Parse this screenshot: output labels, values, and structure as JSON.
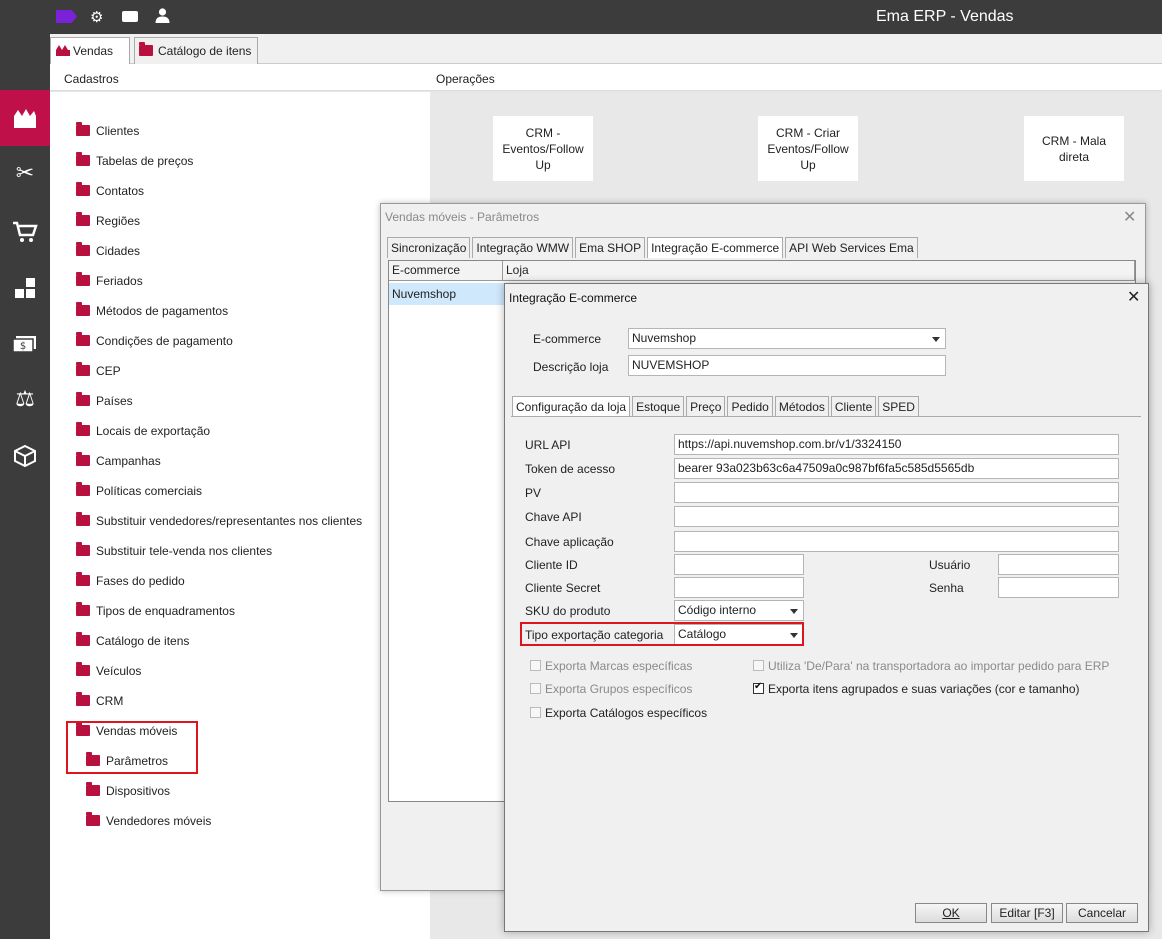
{
  "app": {
    "title": "Ema ERP - Vendas"
  },
  "topbar": {
    "icons": [
      "tag-icon",
      "gear-icon",
      "chat-icon",
      "user-icon"
    ]
  },
  "leftnav": {
    "icons": [
      "sales-icon",
      "tools-icon",
      "cart-icon",
      "inventory-icon",
      "finance-icon",
      "scale-icon",
      "box-icon"
    ]
  },
  "module_tabs": [
    {
      "label": "Vendas"
    },
    {
      "label": "Catálogo de itens"
    }
  ],
  "sections": {
    "cadastros": "Cadastros",
    "operacoes": "Operações"
  },
  "cadastros": [
    "Clientes",
    "Tabelas de preços",
    "Contatos",
    "Regiões",
    "Cidades",
    "Feriados",
    "Métodos de pagamentos",
    "Condições de pagamento",
    "CEP",
    "Países",
    "Locais de exportação",
    "Campanhas",
    "Políticas comerciais",
    "Substituir vendedores/representantes nos clientes",
    "Substituir tele-venda nos clientes",
    "Fases do pedido",
    "Tipos de enquadramentos",
    "Catálogo de itens",
    "Veículos",
    "CRM",
    "Vendas móveis",
    "Parâmetros",
    "Dispositivos",
    "Vendedores móveis"
  ],
  "operacoes": [
    "CRM - Eventos/Follow Up",
    "CRM - Criar Eventos/Follow Up",
    "CRM - Mala direta"
  ],
  "win1": {
    "title": "Vendas móveis - Parâmetros",
    "tabs": [
      "Sincronização",
      "Integração WMW",
      "Ema SHOP",
      "Integração E-commerce",
      "API Web Services Ema"
    ],
    "active_tab": "Integração E-commerce",
    "columns": [
      "E-commerce",
      "Loja"
    ],
    "rows": [
      {
        "ecommerce": "Nuvemshop",
        "loja": ""
      }
    ]
  },
  "win2": {
    "title": "Integração E-commerce",
    "ecommerce_label": "E-commerce",
    "ecommerce_value": "Nuvemshop",
    "descricao_label": "Descrição loja",
    "descricao_value": "NUVEMSHOP",
    "tabs": [
      "Configuração da loja",
      "Estoque",
      "Preço",
      "Pedido",
      "Métodos",
      "Cliente",
      "SPED"
    ],
    "active_tab": "Configuração da loja",
    "fields": {
      "url_api": {
        "label": "URL API",
        "value": "https://api.nuvemshop.com.br/v1/3324150"
      },
      "token": {
        "label": "Token de acesso",
        "value": "bearer 93a023b63c6a47509a0c987bf6fa5c585d5565db"
      },
      "pv": {
        "label": "PV",
        "value": ""
      },
      "chave_api": {
        "label": "Chave API",
        "value": ""
      },
      "chave_aplicacao": {
        "label": "Chave aplicação",
        "value": ""
      },
      "cliente_id": {
        "label": "Cliente ID",
        "value": ""
      },
      "cliente_secret": {
        "label": "Cliente Secret",
        "value": ""
      },
      "usuario": {
        "label": "Usuário",
        "value": ""
      },
      "senha": {
        "label": "Senha",
        "value": ""
      },
      "sku": {
        "label": "SKU do produto",
        "value": "Código interno"
      },
      "tipo_export": {
        "label": "Tipo exportação categoria",
        "value": "Catálogo"
      }
    },
    "checkboxes": {
      "marcas": {
        "label": "Exporta Marcas específicas",
        "checked": false,
        "enabled": false
      },
      "grupos": {
        "label": "Exporta Grupos específicos",
        "checked": false,
        "enabled": false
      },
      "catalogos": {
        "label": "Exporta Catálogos específicos",
        "checked": false,
        "enabled": false
      },
      "depara": {
        "label": "Utiliza 'De/Para' na transportadora ao importar pedido para ERP",
        "checked": false,
        "enabled": false
      },
      "agrupados": {
        "label": "Exporta itens agrupados e suas variações (cor e tamanho)",
        "checked": true,
        "enabled": true
      }
    },
    "buttons": {
      "ok": "OK",
      "editar": "Editar [F3]",
      "cancelar": "Cancelar"
    }
  },
  "colors": {
    "accent": "#c0104a",
    "highlight": "#e0141e",
    "selection": "#cfe8fb"
  }
}
